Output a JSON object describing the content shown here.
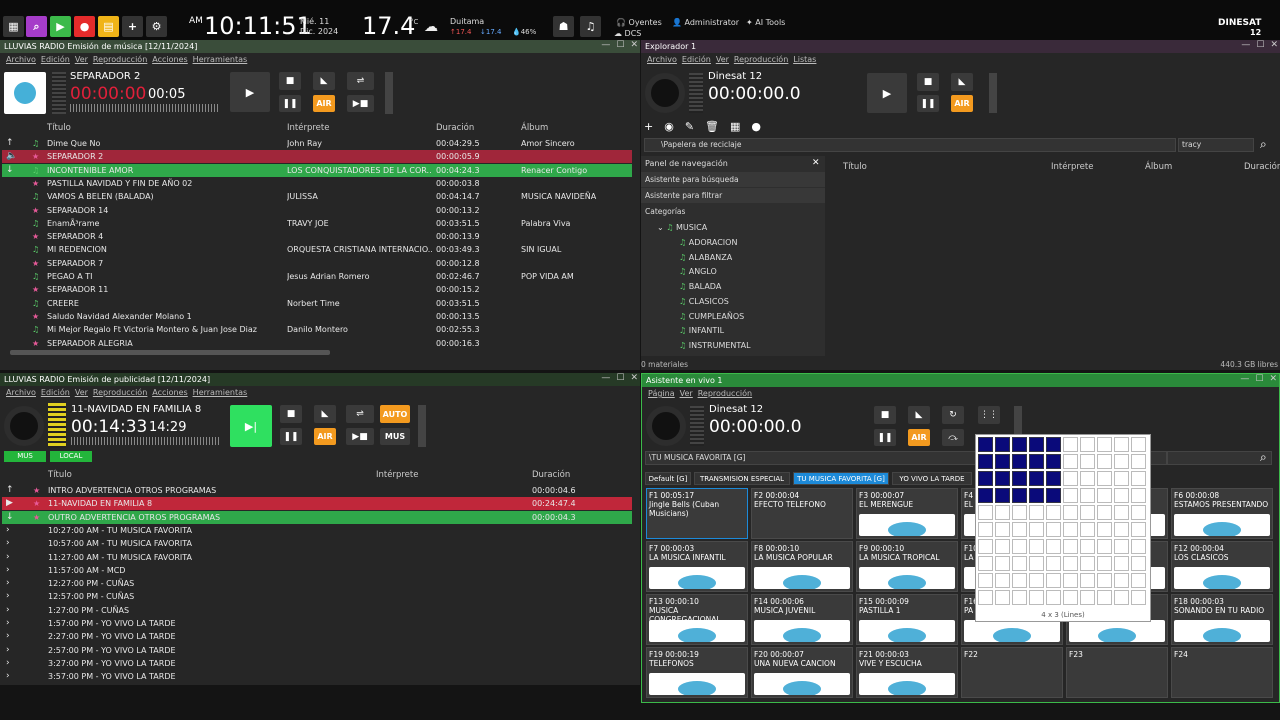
{
  "topbar": {
    "time": "10:11:51",
    "ampm": "AM",
    "day": "Mié. 11",
    "date": "Dic. 2024",
    "temp": "17.4",
    "temp_unit": "°C",
    "city": "Duitama",
    "t_hi": "17.4",
    "t_lo": "17.4",
    "humidity": "46%",
    "listeners": "Oyentes",
    "admin": "Administrator",
    "ai": "AI Tools",
    "dcs": "DCS",
    "brand": "DINESAT",
    "brand_ver": "12"
  },
  "music": {
    "title": "LLUVIAS RADIO Emisión de música [12/11/2024]",
    "menu": [
      "Archivo",
      "Edición",
      "Ver",
      "Reproducción",
      "Acciones",
      "Herramientas"
    ],
    "now": "SEPARADOR 2",
    "counter": "00:00:00",
    "remaining": "00:05",
    "air": "AIR",
    "cols": [
      "Título",
      "Intérprete",
      "Duración",
      "Álbum"
    ],
    "rows": [
      {
        "t": "Dime Que No",
        "a": "John Ray",
        "d": "00:04:29.5",
        "al": "Amor Sincero",
        "k": "music",
        "s": "up"
      },
      {
        "t": "SEPARADOR 2",
        "a": "",
        "d": "00:00:05.9",
        "al": "",
        "k": "star",
        "s": "play"
      },
      {
        "t": "INCONTENIBLE AMOR",
        "a": "LOS CONQUISTADORES DE LA COR...",
        "d": "00:04:24.3",
        "al": "Renacer Contigo",
        "k": "music",
        "s": "down"
      },
      {
        "t": "PASTILLA NAVIDAD Y FIN DE AÑO 02",
        "a": "",
        "d": "00:00:03.8",
        "al": "",
        "k": "star",
        "s": ""
      },
      {
        "t": "VAMOS A BELEN (BALADA)",
        "a": "JULISSA",
        "d": "00:04:14.7",
        "al": "MUSICA NAVIDEÑA",
        "k": "music",
        "s": ""
      },
      {
        "t": "SEPARADOR 14",
        "a": "",
        "d": "00:00:13.2",
        "al": "",
        "k": "star",
        "s": ""
      },
      {
        "t": "EnamÃ³rame",
        "a": "TRAVY JOE",
        "d": "00:03:51.5",
        "al": "Palabra Viva",
        "k": "music",
        "s": ""
      },
      {
        "t": "SEPARADOR 4",
        "a": "",
        "d": "00:00:13.9",
        "al": "",
        "k": "star",
        "s": ""
      },
      {
        "t": "MI REDENCION",
        "a": "ORQUESTA CRISTIANA INTERNACIO...",
        "d": "00:03:49.3",
        "al": "SIN IGUAL",
        "k": "music",
        "s": ""
      },
      {
        "t": "SEPARADOR 7",
        "a": "",
        "d": "00:00:12.8",
        "al": "",
        "k": "star",
        "s": ""
      },
      {
        "t": "PEGAO A TI",
        "a": "Jesus Adrian Romero",
        "d": "00:02:46.7",
        "al": "POP VIDA AM",
        "k": "music",
        "s": ""
      },
      {
        "t": "SEPARADOR 11",
        "a": "",
        "d": "00:00:15.2",
        "al": "",
        "k": "star",
        "s": ""
      },
      {
        "t": "CREERE",
        "a": "Norbert Time",
        "d": "00:03:51.5",
        "al": "",
        "k": "music",
        "s": ""
      },
      {
        "t": "Saludo Navidad Alexander Molano 1",
        "a": "",
        "d": "00:00:13.5",
        "al": "",
        "k": "star",
        "s": ""
      },
      {
        "t": "Mi Mejor Regalo Ft Victoria Montero & Juan Jose Diaz",
        "a": "Danilo Montero",
        "d": "00:02:55.3",
        "al": "",
        "k": "music",
        "s": ""
      },
      {
        "t": "SEPARADOR ALEGRIA",
        "a": "",
        "d": "00:00:16.3",
        "al": "",
        "k": "star",
        "s": ""
      }
    ]
  },
  "explorer": {
    "title": "Explorador 1",
    "menu": [
      "Archivo",
      "Edición",
      "Ver",
      "Reproducción",
      "Listas"
    ],
    "now": "Dinesat 12",
    "counter": "00:00:00.0",
    "air": "AIR",
    "path": "\\Papelera de reciclaje",
    "search": "tracy",
    "nav_title": "Panel de navegación",
    "nav_items": [
      "Asistente para búsqueda",
      "Asistente para filtrar"
    ],
    "categories": "Categorías",
    "root": "MUSICA",
    "tree": [
      "ADORACION",
      "ALABANZA",
      "ANGLO",
      "BALADA",
      "CLASICOS",
      "CUMPLEAÑOS",
      "INFANTIL",
      "INSTRUMENTAL"
    ],
    "cols": [
      "Título",
      "Intérprete",
      "Álbum",
      "Duración"
    ],
    "status_left": "0 materiales",
    "status_right": "440.3 GB libres"
  },
  "ads": {
    "title": "LLUVIAS RADIO Emisión de publicidad [12/11/2024]",
    "menu": [
      "Archivo",
      "Edición",
      "Ver",
      "Reproducción",
      "Acciones",
      "Herramientas"
    ],
    "now": "11-NAVIDAD EN FAMILIA 8",
    "counter": "00:14:33",
    "remaining": "14:29",
    "auto": "AUTO",
    "air": "AIR",
    "mus": "MUS",
    "tag1": "MUS",
    "tag2": "LOCAL",
    "cols": [
      "Título",
      "Intérprete",
      "Duración"
    ],
    "rows": [
      {
        "t": "INTRO ADVERTENCIA OTROS PROGRAMAS",
        "d": "00:00:04.6",
        "s": "up"
      },
      {
        "t": "11-NAVIDAD EN FAMILIA 8",
        "d": "00:24:47.4",
        "s": "play"
      },
      {
        "t": "OUTRO ADVERTENCIA OTROS PROGRAMAS",
        "d": "00:00:04.3",
        "s": "down"
      },
      {
        "t": "10:27:00 AM - TU MUSICA FAVORITA",
        "d": "",
        "s": "blk"
      },
      {
        "t": "10:57:00 AM - TU MUSICA FAVORITA",
        "d": "",
        "s": "blk"
      },
      {
        "t": "11:27:00 AM - TU MUSICA FAVORITA",
        "d": "",
        "s": "blk"
      },
      {
        "t": "11:57:00 AM - MCD",
        "d": "",
        "s": "blk"
      },
      {
        "t": "12:27:00 PM - CUÑAS",
        "d": "",
        "s": "blk"
      },
      {
        "t": "12:57:00 PM - CUÑAS",
        "d": "",
        "s": "blk"
      },
      {
        "t": "1:27:00 PM - CUÑAS",
        "d": "",
        "s": "blk"
      },
      {
        "t": "1:57:00 PM - YO VIVO LA TARDE",
        "d": "",
        "s": "blk"
      },
      {
        "t": "2:27:00 PM - YO VIVO LA TARDE",
        "d": "",
        "s": "blk"
      },
      {
        "t": "2:57:00 PM - YO VIVO LA TARDE",
        "d": "",
        "s": "blk"
      },
      {
        "t": "3:27:00 PM - YO VIVO LA TARDE",
        "d": "",
        "s": "blk"
      },
      {
        "t": "3:57:00 PM - YO VIVO LA TARDE",
        "d": "",
        "s": "blk"
      }
    ]
  },
  "live": {
    "title": "Asistente en vivo 1",
    "menu": [
      "Página",
      "Ver",
      "Reproducción"
    ],
    "now": "Dinesat 12",
    "counter": "00:00:00.0",
    "air": "AIR",
    "group": "\\TU MUSICA FAVORITA [G]",
    "tabs": [
      "Default [G]",
      "TRANSMISION ESPECIAL [G]",
      "TU MUSICA FAVORITA [G]",
      "YO VIVO LA TARDE [G]"
    ],
    "cells": [
      {
        "k": "F1  00:05:17",
        "n": "Jingle Bells (Cuban Musicians)",
        "img": false
      },
      {
        "k": "F2  00:00:04",
        "n": "EFECTO TELEFONO",
        "img": false
      },
      {
        "k": "F3  00:00:07",
        "n": "EL MERENGUE",
        "img": true
      },
      {
        "k": "F4",
        "n": "EL",
        "img": true
      },
      {
        "k": "F5",
        "n": "A",
        "img": true
      },
      {
        "k": "F6  00:00:08",
        "n": "ESTAMOS PRESENTANDO",
        "img": true
      },
      {
        "k": "F7  00:00:03",
        "n": "LA MUSICA INFANTIL",
        "img": true
      },
      {
        "k": "F8  00:00:10",
        "n": "LA MUSICA POPULAR",
        "img": true
      },
      {
        "k": "F9  00:00:10",
        "n": "LA MUSICA TROPICAL",
        "img": true
      },
      {
        "k": "F10",
        "n": "LA",
        "img": true
      },
      {
        "k": "F11",
        "n": "",
        "img": true
      },
      {
        "k": "F12  00:00:04",
        "n": "LOS CLASICOS",
        "img": true
      },
      {
        "k": "F13  00:00:10",
        "n": "MUSICA CONGREGACIONAL",
        "img": true
      },
      {
        "k": "F14  00:00:06",
        "n": "MUSICA JUVENIL",
        "img": true
      },
      {
        "k": "F15  00:00:09",
        "n": "PASTILLA 1",
        "img": true
      },
      {
        "k": "F16",
        "n": "PA",
        "img": true
      },
      {
        "k": "F17",
        "n": "",
        "img": true
      },
      {
        "k": "F18  00:00:03",
        "n": "SONANDO EN TU RADIO",
        "img": true
      },
      {
        "k": "F19  00:00:19",
        "n": "TELEFONOS",
        "img": true
      },
      {
        "k": "F20  00:00:07",
        "n": "UNA NUEVA CANCION",
        "img": true
      },
      {
        "k": "F21  00:00:03",
        "n": "VIVE Y ESCUCHA",
        "img": true
      },
      {
        "k": "F22",
        "n": "",
        "img": false
      },
      {
        "k": "F23",
        "n": "",
        "img": false
      },
      {
        "k": "F24",
        "n": "",
        "img": false
      }
    ],
    "grid_selected_cols": 5,
    "grid_selected_rows": 4,
    "grid_cols": 10,
    "grid_rows": 10,
    "grid_label": "4 x 3 (Lines)"
  }
}
